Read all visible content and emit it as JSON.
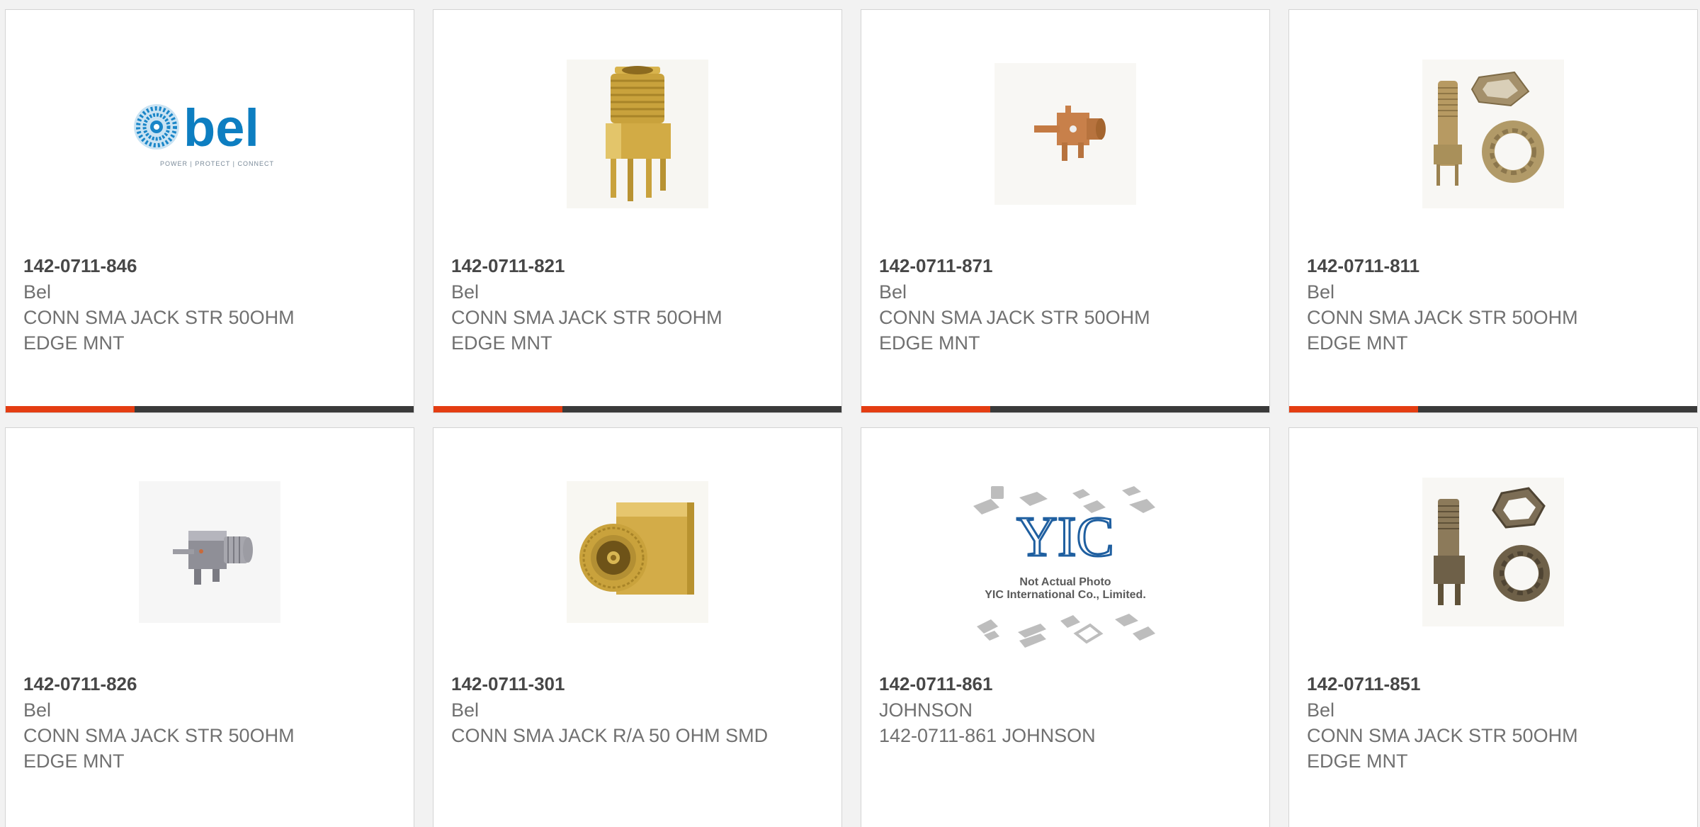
{
  "colors": {
    "accent": "#e43d12",
    "bar_dark": "#3a3a3a",
    "bel_blue": "#0d7ec1",
    "gold": "#c9a23c"
  },
  "products": [
    {
      "part_number": "142-0711-846",
      "manufacturer": "Bel",
      "description": "CONN SMA JACK STR 50OHM EDGE MNT",
      "image": "bel-logo",
      "logo_text": "bel",
      "logo_tagline": "POWER | PROTECT | CONNECT"
    },
    {
      "part_number": "142-0711-821",
      "manufacturer": "Bel",
      "description": "CONN SMA JACK STR 50OHM EDGE MNT",
      "image": "sma-jack-vertical-gold"
    },
    {
      "part_number": "142-0711-871",
      "manufacturer": "Bel",
      "description": "CONN SMA JACK STR 50OHM EDGE MNT",
      "image": "sma-jack-small-copper"
    },
    {
      "part_number": "142-0711-811",
      "manufacturer": "Bel",
      "description": "CONN SMA JACK STR 50OHM EDGE MNT",
      "image": "sma-jack-with-nut-washer"
    },
    {
      "part_number": "142-0711-826",
      "manufacturer": "Bel",
      "description": "CONN SMA JACK STR 50OHM EDGE MNT",
      "image": "sma-jack-silver"
    },
    {
      "part_number": "142-0711-301",
      "manufacturer": "Bel",
      "description": "CONN SMA JACK R/A 50 OHM SMD",
      "image": "sma-jack-right-angle-gold"
    },
    {
      "part_number": "142-0711-861",
      "manufacturer": "JOHNSON",
      "description": "142-0711-861 JOHNSON",
      "image": "yic-placeholder",
      "logo_text": "YIC",
      "caption_line1": "Not Actual Photo",
      "caption_line2": "YIC International Co., Limited."
    },
    {
      "part_number": "142-0711-851",
      "manufacturer": "Bel",
      "description": "CONN SMA JACK STR 50OHM EDGE MNT",
      "image": "sma-jack-with-nut-washer-dark"
    }
  ]
}
